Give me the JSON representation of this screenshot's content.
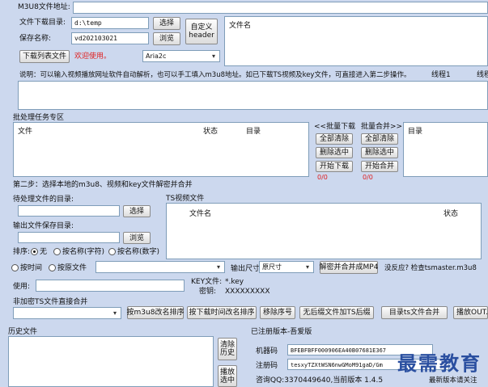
{
  "top": {
    "m3u8_label": "M3U8文件地址:",
    "m3u8_value": ""
  },
  "left": {
    "download_dir_label": "文件下载目录:",
    "download_dir_value": "d:\\temp",
    "select_button": "选择",
    "save_name_label": "保存名称:",
    "save_name_value": "vd202103021",
    "browse_button": "浏览",
    "custom_header_button": "自定义header",
    "download_list_button": "下载列表文件",
    "welcome_text": "欢迎使用。",
    "downloader_select": "Aria2c"
  },
  "file_list": {
    "header_filename": "文件名"
  },
  "info_line": {
    "desc": "说明：可以输入视频播放网址软件自动解析，也可以手工填入m3u8地址。如已下载TS视频及key文件，可直接进入第二步操作。",
    "threads_label": "线程1",
    "threads_cut": "线程"
  },
  "batch": {
    "title": "批处理任务专区",
    "col_file": "文件",
    "col_status": "状态",
    "col_dir": "目录",
    "batch_download_label": "<<批量下载",
    "batch_merge_label": "批量合并>>",
    "clear_all_1": "全部清除",
    "delete_selected_1": "删除选中",
    "start_download": "开始下载",
    "clear_all_2": "全部清除",
    "delete_selected_2": "删除选中",
    "start_merge": "开始合并",
    "count_1": "0/0",
    "count_2": "0/0",
    "right_col_dir": "目录"
  },
  "step2": {
    "title": "第二步：选择本地的m3u8、视频和key文件解密并合并",
    "pending_dir_label": "待处理文件的目录:",
    "select_button": "选择",
    "output_dir_label": "输出文件保存目录:",
    "browse_button": "浏览",
    "ts_video_label": "TS视频文件",
    "col_filename": "文件名",
    "col_status": "状态",
    "sort_label": "排序:",
    "sort_none": "无",
    "sort_name_char": "按名称(字符)",
    "sort_name_num": "按名称(数字)",
    "sort_time": "按时间",
    "sort_file": "按原文件",
    "output_size_label": "输出尺寸",
    "output_size_select": "原尺寸",
    "decrypt_merge_button": "解密并合并成MP4",
    "no_response_text": "没反应? 检查tsmaster.m3u8",
    "use_label": "使用:",
    "key_file_label": "KEY文件:",
    "key_file_value": "*.key",
    "secret_label": "密钥:",
    "secret_value": "XXXXXXXXX"
  },
  "direct_merge": {
    "title": "非加密TS文件直接合并",
    "rename_m3u8_button": "按m3u8改名排序",
    "rename_time_button": "按下载时间改名排序",
    "remove_seq_button": "移除序号",
    "no_suffix_button": "无后缀文件加TS后缀",
    "merge_dir_button": "目录ts文件合并",
    "play_button": "播放OUT.M"
  },
  "history": {
    "title": "历史文件",
    "clear_button": "清除历史",
    "play_selected_button": "播放选中"
  },
  "registration": {
    "title": "已注册版本-吾爱版",
    "machine_code_label": "机器码",
    "machine_code_value": "BFEBFBFF000906EA40B07681E367",
    "reg_code_label": "注册码",
    "reg_code_value": "tesxyTZXtWSN6nwGMoM91gaD/Gm",
    "contact": "咨询QQ:3370449640,当前版本 1.4.5",
    "latest_note": "最新版本请关注"
  },
  "watermark": "最需教育"
}
